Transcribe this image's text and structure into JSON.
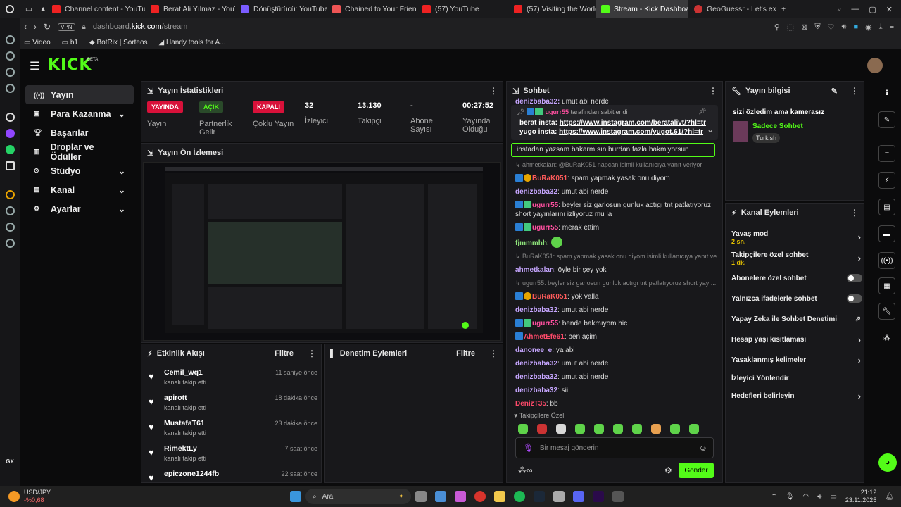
{
  "browser": {
    "tabs": [
      "Channel content - YouTub",
      "Berat Ali Yılmaz - YouTub",
      "Dönüştürücü: YouTube M",
      "Chained to Your Friends",
      "(57) YouTube",
      "(57) Visiting the World's",
      "Stream - Kick Dashboard",
      "GeoGuessr - Let's explor"
    ],
    "url_prefix": "dashboard.",
    "url_host": "kick.com",
    "url_path": "/stream",
    "vpn": "VPN",
    "bookmarks": [
      "Video",
      "b1",
      "BotRix | Sorteos",
      "Handy tools for A..."
    ]
  },
  "kick": {
    "logo": "KICK",
    "logo_beta": "BETA"
  },
  "nav": [
    {
      "label": "Yayın",
      "icon": "broadcast-icon",
      "chev": false
    },
    {
      "label": "Para Kazanma",
      "icon": "money-icon",
      "chev": true
    },
    {
      "label": "Başarılar",
      "icon": "trophy-icon",
      "chev": false
    },
    {
      "label": "Droplar ve Ödüller",
      "icon": "gift-icon",
      "chev": false
    },
    {
      "label": "Stüdyo",
      "icon": "studio-icon",
      "chev": true
    },
    {
      "label": "Kanal",
      "icon": "channel-icon",
      "chev": true
    },
    {
      "label": "Ayarlar",
      "icon": "gear-icon",
      "chev": true
    }
  ],
  "stats": {
    "title": "Yayın İstatistikleri",
    "items": [
      {
        "badge": "YAYINDA",
        "label": "Yayın"
      },
      {
        "badge": "AÇIK",
        "label": "Partnerlik Gelir"
      },
      {
        "badge": "KAPALI",
        "label": "Çoklu Yayın"
      }
    ],
    "values": [
      {
        "value": "32",
        "label": "İzleyici"
      },
      {
        "value": "13.130",
        "label": "Takipçi"
      },
      {
        "value": "-",
        "label": "Abone Sayısı"
      },
      {
        "value": "00:27:52",
        "label": "Yayında Olduğu"
      }
    ]
  },
  "preview": {
    "title": "Yayın Ön İzlemesi"
  },
  "activity": {
    "title": "Etkinlik Akışı",
    "filter": "Filtre",
    "items": [
      {
        "name": "Cemil_wq1",
        "action": "kanalı takip etti",
        "time": "11 saniye önce"
      },
      {
        "name": "apirott",
        "action": "kanalı takip etti",
        "time": "18 dakika önce"
      },
      {
        "name": "MustafaT61",
        "action": "kanalı takip etti",
        "time": "23 dakika önce"
      },
      {
        "name": "RimektLy",
        "action": "kanalı takip etti",
        "time": "7 saat önce"
      },
      {
        "name": "epiczone1244fb",
        "action": "",
        "time": "22 saat önce"
      }
    ]
  },
  "moderation": {
    "title": "Denetim Eylemleri",
    "filter": "Filtre"
  },
  "chat": {
    "title": "Sohbet",
    "pinned_by": "ugurr55",
    "pinned_suffix": "tarafından sabitlendi",
    "pinned1_label": "berat insta:",
    "pinned1_link": "https://www.instagram.com/beratalivt/?hl=tr",
    "pinned2_label": "yugo insta:",
    "pinned2_link": "https://www.instagram.com/yugot.61/?hl=tr",
    "top_user": "denizbaba32:",
    "top_msg": "umut abi nerde",
    "highlight": "instadan yazsam bakarmısın burdan fazla bakmiyorsun",
    "messages": [
      {
        "user": "ahmetkalan",
        "msg": "@BuRaK051 napcan isimli kullanıcıya yanıt veriyor",
        "color": "#888",
        "reply": true
      },
      {
        "user": "BuRaK051",
        "msg": "spam yapmak yasak onu diyom",
        "color": "#ff5b5b"
      },
      {
        "user": "denizbaba32",
        "msg": "umut abi nerde",
        "color": "#c6a6ff"
      },
      {
        "user": "ugurr55",
        "msg": "beyler siz garlosun gunluk actıgı tnt patlatıyoruz short yayınlarını izliyoruz mu la",
        "color": "#ff4fa0"
      },
      {
        "user": "ugurr55",
        "msg": "merak ettim",
        "color": "#ff4fa0"
      },
      {
        "user": "fjmmmhh",
        "msg": "",
        "color": "#8ee37a"
      },
      {
        "user": "BuRaK051",
        "msg": "spam yapmak yasak onu diyom isimli kullanıcıya yanıt ve...",
        "color": "#888",
        "reply": true
      },
      {
        "user": "ahmetkalan",
        "msg": "öyle bir şey yok",
        "color": "#c6a6ff"
      },
      {
        "user": "ugurr55",
        "msg": "beyler siz garlosun gunluk actıgı tnt patlatıyoruz short yayı...",
        "color": "#888",
        "reply": true
      },
      {
        "user": "BuRaK051",
        "msg": "yok valla",
        "color": "#ff5b5b"
      },
      {
        "user": "denizbaba32",
        "msg": "umut abi nerde",
        "color": "#c6a6ff"
      },
      {
        "user": "ugurr55",
        "msg": "bende bakmıyom hic",
        "color": "#ff4fa0"
      },
      {
        "user": "AhmetEfe61",
        "msg": "ben açim",
        "color": "#ff4a6a"
      },
      {
        "user": "danonee_e",
        "msg": "ya abi",
        "color": "#c6a6ff"
      },
      {
        "user": "denizbaba32",
        "msg": "umut abi nerde",
        "color": "#c6a6ff"
      },
      {
        "user": "denizbaba32",
        "msg": "umut abi nerde",
        "color": "#c6a6ff"
      },
      {
        "user": "denizbaba32",
        "msg": "sii",
        "color": "#c6a6ff"
      },
      {
        "user": "DenizT35",
        "msg": "bb",
        "color": "#ff4a6a"
      }
    ],
    "followers_only": "Takipçilere Özel",
    "input_placeholder": "Bir mesaj gönderin",
    "send": "Gönder"
  },
  "info": {
    "title": "Yayın bilgisi",
    "stream_title": "sizi özledim ama kamerasız",
    "category": "Sadece Sohbet",
    "language": "Turkish"
  },
  "actions": {
    "title": "Kanal Eylemleri",
    "slow_mode": "Yavaş mod",
    "slow_value": "2 sn.",
    "followers_chat": "Takipçilere özel sohbet",
    "followers_value": "1 dk.",
    "subs_chat": "Abonelere özel sohbet",
    "emotes_chat": "Yalnızca ifadelerle sohbet",
    "ai_moderation": "Yapay Zeka ile Sohbet Denetimi",
    "age_limits": "Hesap yaşı kısıtlaması",
    "banned_words": "Yasaklanmış kelimeler",
    "raid": "İzleyici Yönlendir",
    "goals": "Hedefleri belirleyin"
  },
  "taskbar": {
    "ticker": "USD/JPY",
    "ticker_change": "-%0,68",
    "search": "Ara",
    "time": "21:12",
    "date": "23.11.2025"
  },
  "colors": {
    "kick_green": "#53fc18",
    "bg": "#0b0b0c",
    "panel": "#18181b"
  }
}
